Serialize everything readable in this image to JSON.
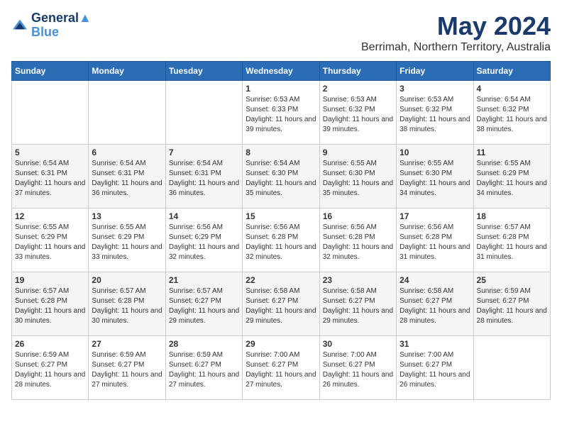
{
  "logo": {
    "line1": "General",
    "line2": "Blue"
  },
  "title": "May 2024",
  "subtitle": "Berrimah, Northern Territory, Australia",
  "days_of_week": [
    "Sunday",
    "Monday",
    "Tuesday",
    "Wednesday",
    "Thursday",
    "Friday",
    "Saturday"
  ],
  "weeks": [
    [
      {
        "day": "",
        "sunrise": "",
        "sunset": "",
        "daylight": ""
      },
      {
        "day": "",
        "sunrise": "",
        "sunset": "",
        "daylight": ""
      },
      {
        "day": "",
        "sunrise": "",
        "sunset": "",
        "daylight": ""
      },
      {
        "day": "1",
        "sunrise": "6:53 AM",
        "sunset": "6:33 PM",
        "daylight": "11 hours and 39 minutes."
      },
      {
        "day": "2",
        "sunrise": "6:53 AM",
        "sunset": "6:32 PM",
        "daylight": "11 hours and 39 minutes."
      },
      {
        "day": "3",
        "sunrise": "6:53 AM",
        "sunset": "6:32 PM",
        "daylight": "11 hours and 38 minutes."
      },
      {
        "day": "4",
        "sunrise": "6:54 AM",
        "sunset": "6:32 PM",
        "daylight": "11 hours and 38 minutes."
      }
    ],
    [
      {
        "day": "5",
        "sunrise": "6:54 AM",
        "sunset": "6:31 PM",
        "daylight": "11 hours and 37 minutes."
      },
      {
        "day": "6",
        "sunrise": "6:54 AM",
        "sunset": "6:31 PM",
        "daylight": "11 hours and 36 minutes."
      },
      {
        "day": "7",
        "sunrise": "6:54 AM",
        "sunset": "6:31 PM",
        "daylight": "11 hours and 36 minutes."
      },
      {
        "day": "8",
        "sunrise": "6:54 AM",
        "sunset": "6:30 PM",
        "daylight": "11 hours and 35 minutes."
      },
      {
        "day": "9",
        "sunrise": "6:55 AM",
        "sunset": "6:30 PM",
        "daylight": "11 hours and 35 minutes."
      },
      {
        "day": "10",
        "sunrise": "6:55 AM",
        "sunset": "6:30 PM",
        "daylight": "11 hours and 34 minutes."
      },
      {
        "day": "11",
        "sunrise": "6:55 AM",
        "sunset": "6:29 PM",
        "daylight": "11 hours and 34 minutes."
      }
    ],
    [
      {
        "day": "12",
        "sunrise": "6:55 AM",
        "sunset": "6:29 PM",
        "daylight": "11 hours and 33 minutes."
      },
      {
        "day": "13",
        "sunrise": "6:55 AM",
        "sunset": "6:29 PM",
        "daylight": "11 hours and 33 minutes."
      },
      {
        "day": "14",
        "sunrise": "6:56 AM",
        "sunset": "6:29 PM",
        "daylight": "11 hours and 32 minutes."
      },
      {
        "day": "15",
        "sunrise": "6:56 AM",
        "sunset": "6:28 PM",
        "daylight": "11 hours and 32 minutes."
      },
      {
        "day": "16",
        "sunrise": "6:56 AM",
        "sunset": "6:28 PM",
        "daylight": "11 hours and 32 minutes."
      },
      {
        "day": "17",
        "sunrise": "6:56 AM",
        "sunset": "6:28 PM",
        "daylight": "11 hours and 31 minutes."
      },
      {
        "day": "18",
        "sunrise": "6:57 AM",
        "sunset": "6:28 PM",
        "daylight": "11 hours and 31 minutes."
      }
    ],
    [
      {
        "day": "19",
        "sunrise": "6:57 AM",
        "sunset": "6:28 PM",
        "daylight": "11 hours and 30 minutes."
      },
      {
        "day": "20",
        "sunrise": "6:57 AM",
        "sunset": "6:28 PM",
        "daylight": "11 hours and 30 minutes."
      },
      {
        "day": "21",
        "sunrise": "6:57 AM",
        "sunset": "6:27 PM",
        "daylight": "11 hours and 29 minutes."
      },
      {
        "day": "22",
        "sunrise": "6:58 AM",
        "sunset": "6:27 PM",
        "daylight": "11 hours and 29 minutes."
      },
      {
        "day": "23",
        "sunrise": "6:58 AM",
        "sunset": "6:27 PM",
        "daylight": "11 hours and 29 minutes."
      },
      {
        "day": "24",
        "sunrise": "6:58 AM",
        "sunset": "6:27 PM",
        "daylight": "11 hours and 28 minutes."
      },
      {
        "day": "25",
        "sunrise": "6:59 AM",
        "sunset": "6:27 PM",
        "daylight": "11 hours and 28 minutes."
      }
    ],
    [
      {
        "day": "26",
        "sunrise": "6:59 AM",
        "sunset": "6:27 PM",
        "daylight": "11 hours and 28 minutes."
      },
      {
        "day": "27",
        "sunrise": "6:59 AM",
        "sunset": "6:27 PM",
        "daylight": "11 hours and 27 minutes."
      },
      {
        "day": "28",
        "sunrise": "6:59 AM",
        "sunset": "6:27 PM",
        "daylight": "11 hours and 27 minutes."
      },
      {
        "day": "29",
        "sunrise": "7:00 AM",
        "sunset": "6:27 PM",
        "daylight": "11 hours and 27 minutes."
      },
      {
        "day": "30",
        "sunrise": "7:00 AM",
        "sunset": "6:27 PM",
        "daylight": "11 hours and 26 minutes."
      },
      {
        "day": "31",
        "sunrise": "7:00 AM",
        "sunset": "6:27 PM",
        "daylight": "11 hours and 26 minutes."
      },
      {
        "day": "",
        "sunrise": "",
        "sunset": "",
        "daylight": ""
      }
    ]
  ]
}
